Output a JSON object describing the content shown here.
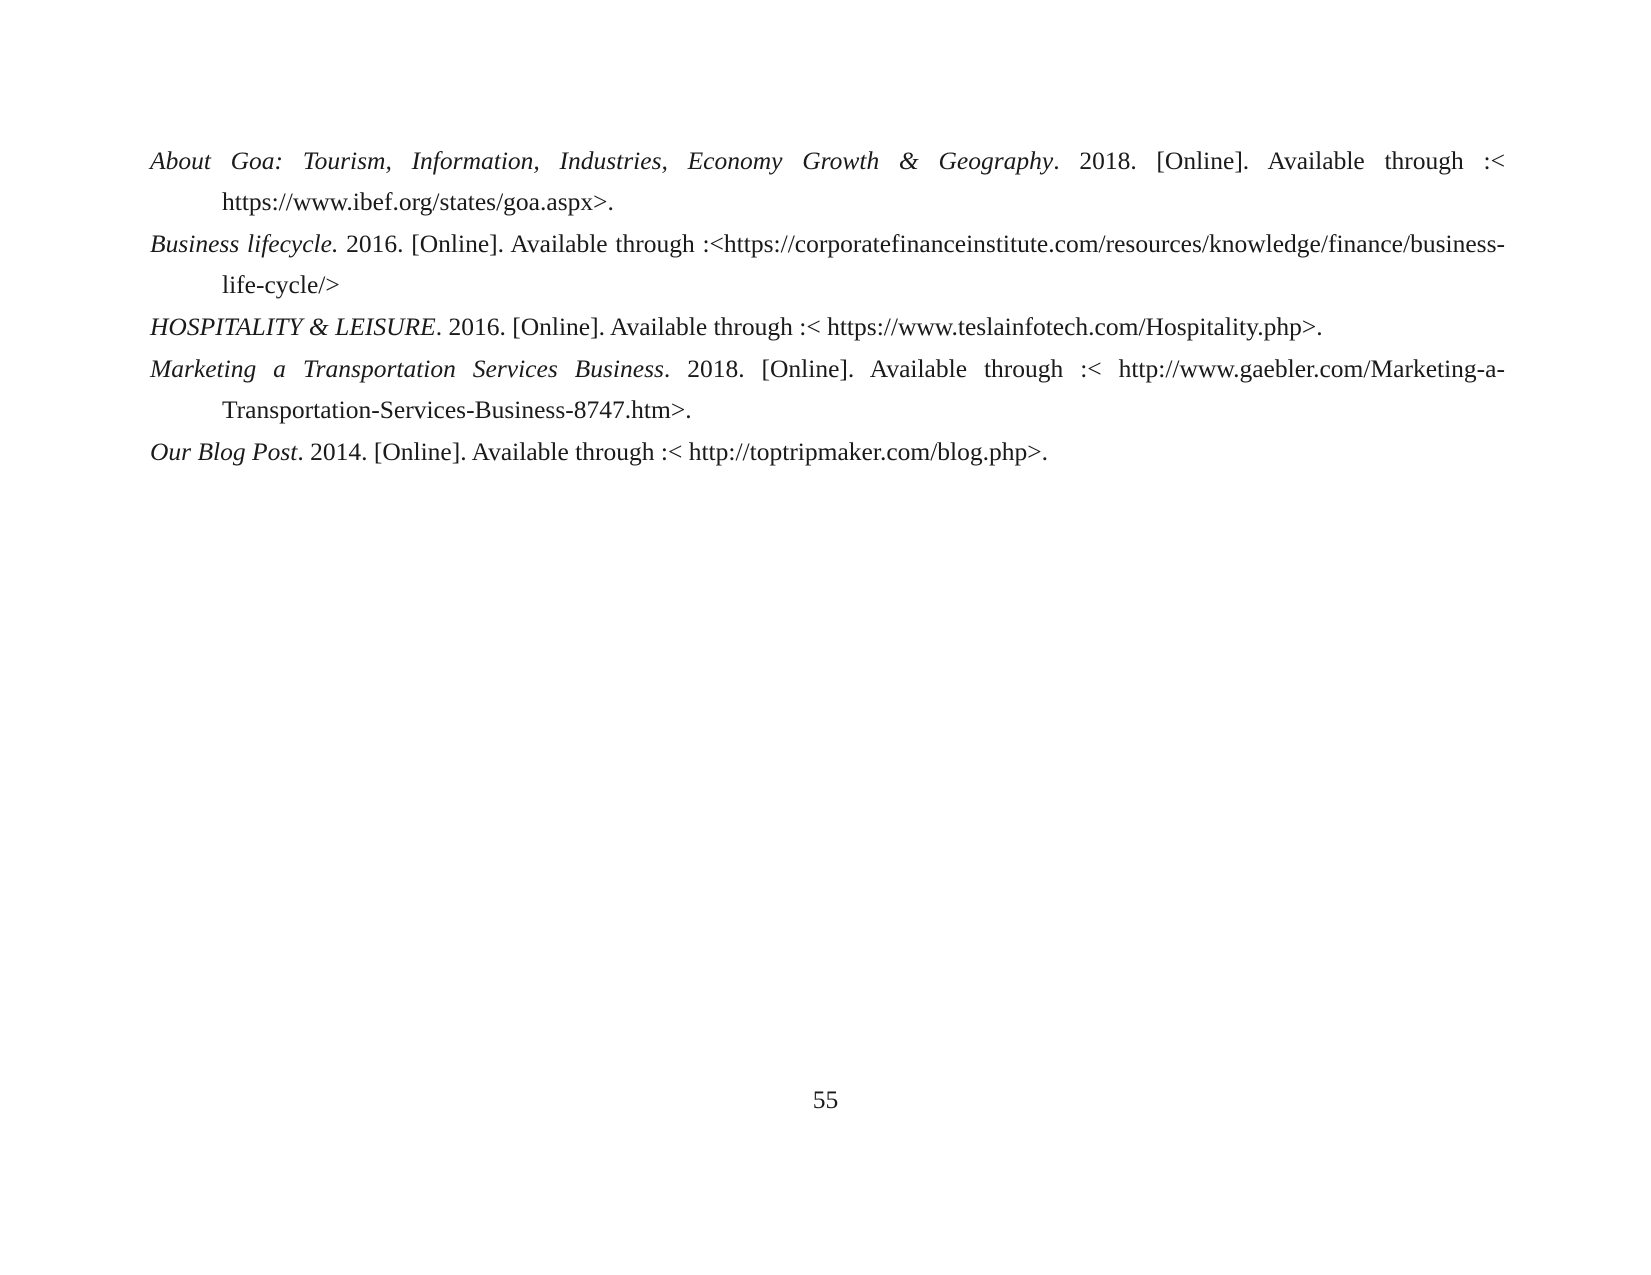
{
  "document": {
    "page_number": "55",
    "references": [
      {
        "title": "About Goa: Tourism, Information, Industries, Economy Growth & Geography",
        "rest": ". 2018. [Online]. Available through :< https://www.ibef.org/states/goa.aspx>.",
        "justified": true
      },
      {
        "title": "Business lifecycle.",
        "rest": " 2016. [Online]. Available through :<https://corporatefinanceinstitute.com/resources/knowledge/finance/business-life-cycle/>",
        "justified": true
      },
      {
        "title": "HOSPITALITY & LEISURE",
        "rest": ". 2016. [Online]. Available through :< https://www.teslainfotech.com/Hospitality.php>.",
        "justified": false
      },
      {
        "title": "Marketing a Transportation Services Business",
        "rest": ". 2018. [Online]. Available through :< http://www.gaebler.com/Marketing-a-Transportation-Services-Business-8747.htm>.",
        "justified": true
      },
      {
        "title": "Our Blog Post",
        "rest": ". 2014. [Online]. Available through :< http://toptripmaker.com/blog.php>.",
        "justified": false
      }
    ]
  }
}
